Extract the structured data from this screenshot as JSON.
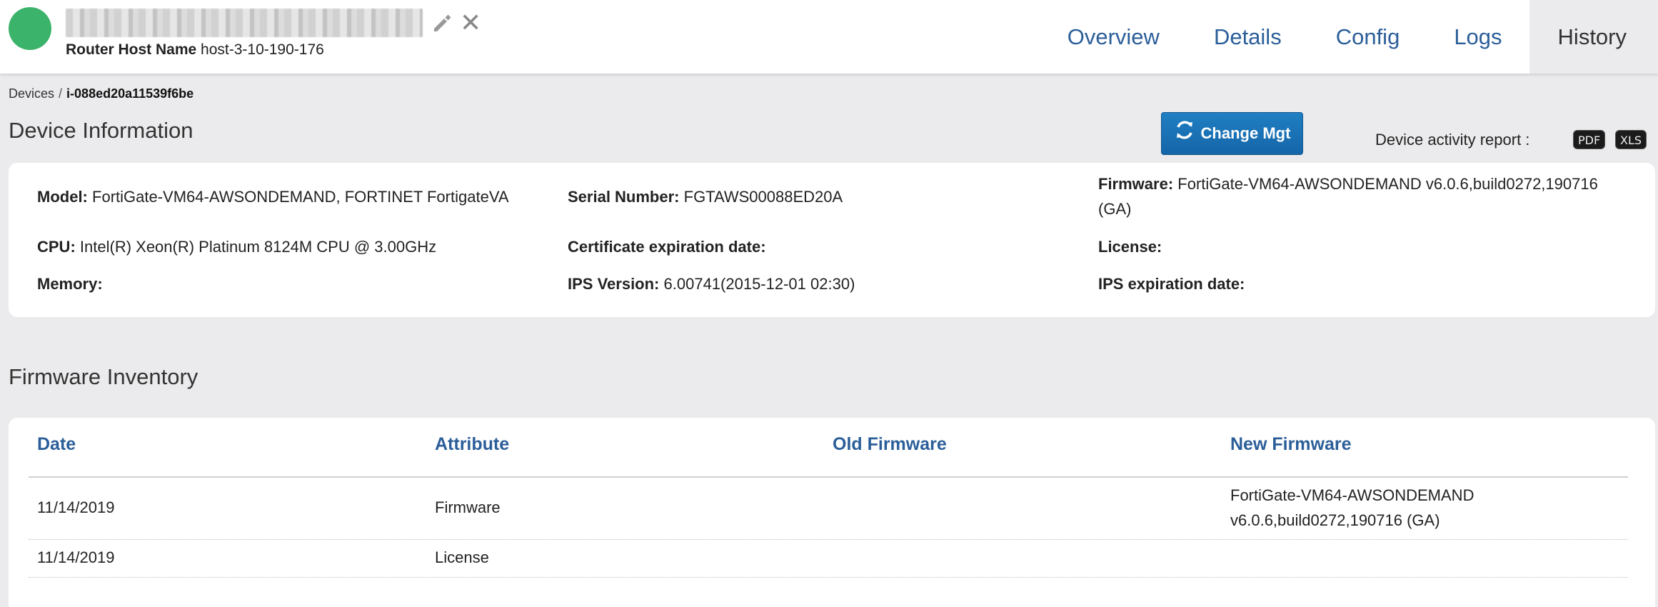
{
  "header": {
    "status_color": "#3cb36b",
    "router_host_name_label": "Router Host Name",
    "router_host_name_value": "host-3-10-190-176",
    "tabs": [
      {
        "label": "Overview",
        "active": false
      },
      {
        "label": "Details",
        "active": false
      },
      {
        "label": "Config",
        "active": false
      },
      {
        "label": "Logs",
        "active": false
      },
      {
        "label": "History",
        "active": true
      }
    ]
  },
  "breadcrumb": {
    "root": "Devices",
    "separator": "/",
    "current": "i-088ed20a11539f6be"
  },
  "device_info": {
    "title": "Device Information",
    "change_mgt_label": "Change Mgt",
    "activity_report_label": "Device activity report :",
    "report_formats": [
      "PDF",
      "XLS"
    ],
    "fields": {
      "model": {
        "label": "Model:",
        "value": "FortiGate-VM64-AWSONDEMAND, FORTINET FortigateVA"
      },
      "serial": {
        "label": "Serial Number:",
        "value": "FGTAWS00088ED20A"
      },
      "firmware": {
        "label": "Firmware:",
        "value": "FortiGate-VM64-AWSONDEMAND v6.0.6,build0272,190716",
        "value_line2": "(GA)"
      },
      "cpu": {
        "label": "CPU:",
        "value": "Intel(R) Xeon(R) Platinum 8124M CPU @ 3.00GHz"
      },
      "cert_exp": {
        "label": "Certificate expiration date:",
        "value": ""
      },
      "license": {
        "label": "License:",
        "value": ""
      },
      "memory": {
        "label": "Memory:",
        "value": ""
      },
      "ips_version": {
        "label": "IPS Version:",
        "value": "6.00741(2015-12-01 02:30)"
      },
      "ips_exp": {
        "label": "IPS expiration date:",
        "value": ""
      }
    }
  },
  "firmware_inventory": {
    "title": "Firmware Inventory",
    "columns": [
      "Date",
      "Attribute",
      "Old Firmware",
      "New Firmware"
    ],
    "rows": [
      {
        "date": "11/14/2019",
        "attribute": "Firmware",
        "old": "",
        "new_line1": "FortiGate-VM64-AWSONDEMAND",
        "new_line2": "v6.0.6,build0272,190716 (GA)"
      },
      {
        "date": "11/14/2019",
        "attribute": "License",
        "old": "",
        "new_line1": "",
        "new_line2": ""
      }
    ]
  }
}
